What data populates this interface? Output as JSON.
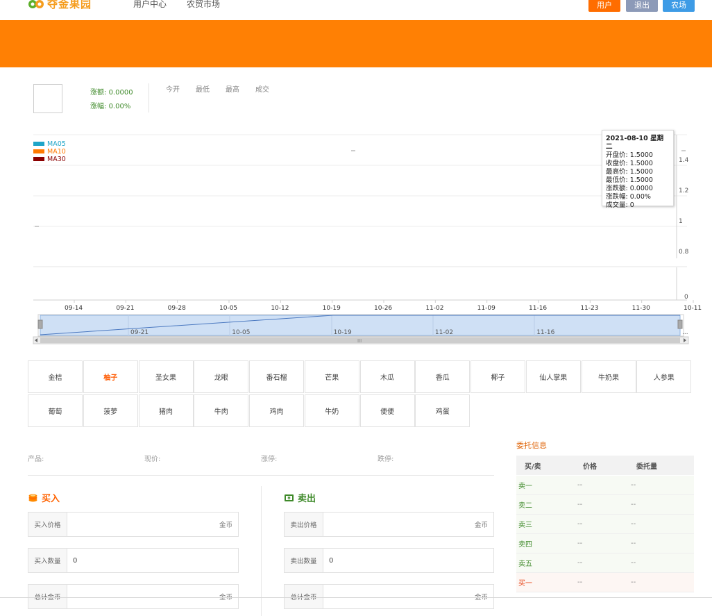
{
  "header": {
    "logo_text": "夺金果园",
    "nav": [
      "用户中心",
      "农贸市场"
    ],
    "buttons": [
      {
        "label": "用户",
        "color": "#ff6d00"
      },
      {
        "label": "退出",
        "color": "#8c9ab8"
      },
      {
        "label": "农场",
        "color": "#3d9be6"
      }
    ],
    "banner_color": "#ff8004"
  },
  "ticker": {
    "change_amount_label": "涨额:",
    "change_amount_value": "0.0000",
    "change_pct_label": "涨幅:",
    "change_pct_value": "0.00%",
    "stats": [
      "今开",
      "最低",
      "最高",
      "成交"
    ]
  },
  "chart_data": {
    "type": "line",
    "legend": [
      {
        "name": "MA05",
        "color": "#1ea5c8"
      },
      {
        "name": "MA10",
        "color": "#ff7a00"
      },
      {
        "name": "MA30",
        "color": "#8b0000"
      }
    ],
    "x_ticks": [
      "09-14",
      "09-21",
      "09-28",
      "10-05",
      "10-12",
      "10-19",
      "10-26",
      "11-02",
      "11-09",
      "11-16",
      "11-23",
      "11-30",
      "10-11"
    ],
    "y_ticks": [
      "1.4",
      "1.2",
      "1",
      "0.8"
    ],
    "volume_ticks": [
      "0"
    ],
    "navigator_ticks": [
      "09-21",
      "10-05",
      "10-19",
      "11-02",
      "11-16"
    ],
    "navigator_trail": "...",
    "scrollbar_grip": "III",
    "series": [
      {
        "name": "MA05",
        "values": []
      },
      {
        "name": "MA10",
        "values": []
      },
      {
        "name": "MA30",
        "values": []
      }
    ]
  },
  "tooltip": {
    "date": "2021-08-10 星期二",
    "lines": [
      "开盘价: 1.5000",
      "收盘价: 1.5000",
      "最高价: 1.5000",
      "最低价: 1.5000",
      "涨跌额: 0.0000",
      "涨跌幅: 0.00%",
      "成交量: 0"
    ]
  },
  "products": {
    "active_index": 1,
    "items": [
      "金桔",
      "柚子",
      "圣女果",
      "龙眼",
      "番石榴",
      "芒果",
      "木瓜",
      "香瓜",
      "椰子",
      "仙人掌果",
      "牛奶果",
      "人参果",
      "葡萄",
      "菠萝",
      "猪肉",
      "牛肉",
      "鸡肉",
      "牛奶",
      "便便",
      "鸡蛋"
    ]
  },
  "trade_info": {
    "labels": [
      "产品:",
      "现价:",
      "涨停:",
      "跌停:"
    ]
  },
  "buy": {
    "title": "买入",
    "price_label": "买入价格",
    "price_unit": "金币",
    "qty_label": "买入数量",
    "qty_value": "0",
    "total_label": "总计金币",
    "total_unit": "金币",
    "color": "#ff6200"
  },
  "sell": {
    "title": "卖出",
    "price_label": "卖出价格",
    "price_unit": "金币",
    "qty_label": "卖出数量",
    "qty_value": "0",
    "total_label": "总计金币",
    "total_unit": "金币",
    "color": "#3f8a2a"
  },
  "orderbook": {
    "title": "委托信息",
    "headers": [
      "买/卖",
      "价格",
      "委托量"
    ],
    "rows": [
      {
        "side": "卖一",
        "price": "--",
        "amount": "--",
        "type": "sell"
      },
      {
        "side": "卖二",
        "price": "--",
        "amount": "--",
        "type": "sell"
      },
      {
        "side": "卖三",
        "price": "--",
        "amount": "--",
        "type": "sell"
      },
      {
        "side": "卖四",
        "price": "--",
        "amount": "--",
        "type": "sell"
      },
      {
        "side": "卖五",
        "price": "--",
        "amount": "--",
        "type": "sell"
      },
      {
        "side": "买一",
        "price": "--",
        "amount": "--",
        "type": "buy"
      }
    ]
  }
}
